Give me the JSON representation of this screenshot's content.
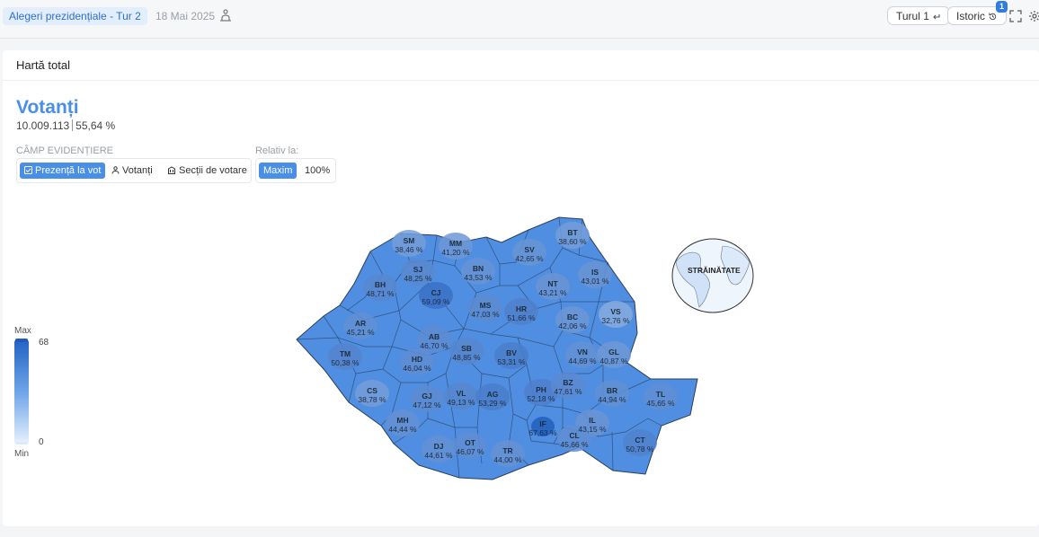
{
  "header": {
    "election_label": "Alegeri prezidențiale - Tur 2",
    "date": "18 Mai 2025",
    "round_button": "Turul 1",
    "history_button": "Istoric",
    "history_badge": "1"
  },
  "card": {
    "title": "Hartă total",
    "metric_title": "Votanți",
    "voters_count": "10.009.113",
    "voters_percent": "55,64 %"
  },
  "controls": {
    "highlight_label": "CÂMP EVIDENȚIERE",
    "relative_label": "Relativ la:",
    "options": [
      "Prezență la vot",
      "Votanți",
      "Secții de votare"
    ],
    "relative_options": [
      "Maxim",
      "100%"
    ],
    "active_option": "Prezență la vot",
    "active_relative": "Maxim"
  },
  "legend": {
    "max_label": "Max",
    "min_label": "Min",
    "max_value": "68",
    "min_value": "0",
    "color_max": "#1f5ebd",
    "color_min": "#e6f1fc"
  },
  "map": {
    "abroad_label": "STRĂINĂTATE",
    "counties": [
      {
        "code": "SM",
        "value": "38,46 %"
      },
      {
        "code": "MM",
        "value": "41,20 %"
      },
      {
        "code": "SV",
        "value": "42,65 %"
      },
      {
        "code": "BT",
        "value": "38,60 %"
      },
      {
        "code": "SJ",
        "value": "48,25 %"
      },
      {
        "code": "BN",
        "value": "43,53 %"
      },
      {
        "code": "IS",
        "value": "43,01 %"
      },
      {
        "code": "BH",
        "value": "48,71 %"
      },
      {
        "code": "CJ",
        "value": "59,09 %"
      },
      {
        "code": "NT",
        "value": "43,21 %"
      },
      {
        "code": "MS",
        "value": "47,03 %"
      },
      {
        "code": "HR",
        "value": "51,66 %"
      },
      {
        "code": "VS",
        "value": "32,76 %"
      },
      {
        "code": "AR",
        "value": "45,21 %"
      },
      {
        "code": "BC",
        "value": "42,06 %"
      },
      {
        "code": "AB",
        "value": "46,70 %"
      },
      {
        "code": "TM",
        "value": "50,38 %"
      },
      {
        "code": "HD",
        "value": "46,04 %"
      },
      {
        "code": "SB",
        "value": "48,85 %"
      },
      {
        "code": "BV",
        "value": "53,31 %"
      },
      {
        "code": "VN",
        "value": "44,69 %"
      },
      {
        "code": "GL",
        "value": "40,87 %"
      },
      {
        "code": "CS",
        "value": "38,78 %"
      },
      {
        "code": "VL",
        "value": "49,13 %"
      },
      {
        "code": "GJ",
        "value": "47,12 %"
      },
      {
        "code": "AG",
        "value": "53,29 %"
      },
      {
        "code": "PH",
        "value": "52,18 %"
      },
      {
        "code": "BZ",
        "value": "47,61 %"
      },
      {
        "code": "BR",
        "value": "44,94 %"
      },
      {
        "code": "TL",
        "value": "45,65 %"
      },
      {
        "code": "MH",
        "value": "44,44 %"
      },
      {
        "code": "IF",
        "value": "67,63 %"
      },
      {
        "code": "IL",
        "value": "43,15 %"
      },
      {
        "code": "DJ",
        "value": "44,61 %"
      },
      {
        "code": "OT",
        "value": "46,07 %"
      },
      {
        "code": "TR",
        "value": "44,00 %"
      },
      {
        "code": "CL",
        "value": "45,66 %"
      },
      {
        "code": "CT",
        "value": "50,78 %"
      }
    ]
  }
}
